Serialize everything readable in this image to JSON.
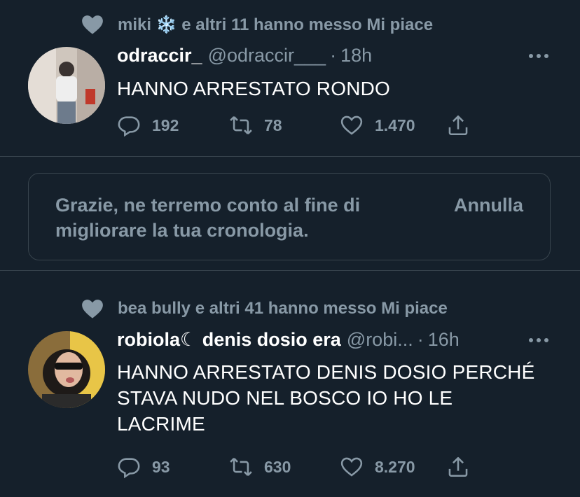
{
  "tweet1": {
    "social_context": "miki ❄️ e altri 11 hanno messo Mi piace",
    "name": "odraccir_",
    "handle": "@odraccir___",
    "time": "18h",
    "text": "HANNO ARRESTATO RONDO",
    "replies": "192",
    "retweets": "78",
    "likes": "1.470"
  },
  "feedback": {
    "message": "Grazie, ne terremo conto al fine di migliorare la tua cronologia.",
    "undo_label": "Annulla"
  },
  "tweet2": {
    "social_context": "bea bully e altri 41 hanno messo Mi piace",
    "name": "robiola☾ denis dosio era",
    "handle": "@robi...",
    "time": "16h",
    "text": "HANNO ARRESTATO DENIS DOSIO PERCHÉ STAVA NUDO NEL BOSCO IO HO LE LACRIME",
    "replies": "93",
    "retweets": "630",
    "likes": "8.270"
  },
  "colors": {
    "background": "#15202b",
    "muted": "#8899a6",
    "divider": "#38444d",
    "text": "#ffffff"
  },
  "icons": [
    "heart-filled-icon",
    "more-icon",
    "reply-icon",
    "retweet-icon",
    "like-icon",
    "share-icon"
  ]
}
